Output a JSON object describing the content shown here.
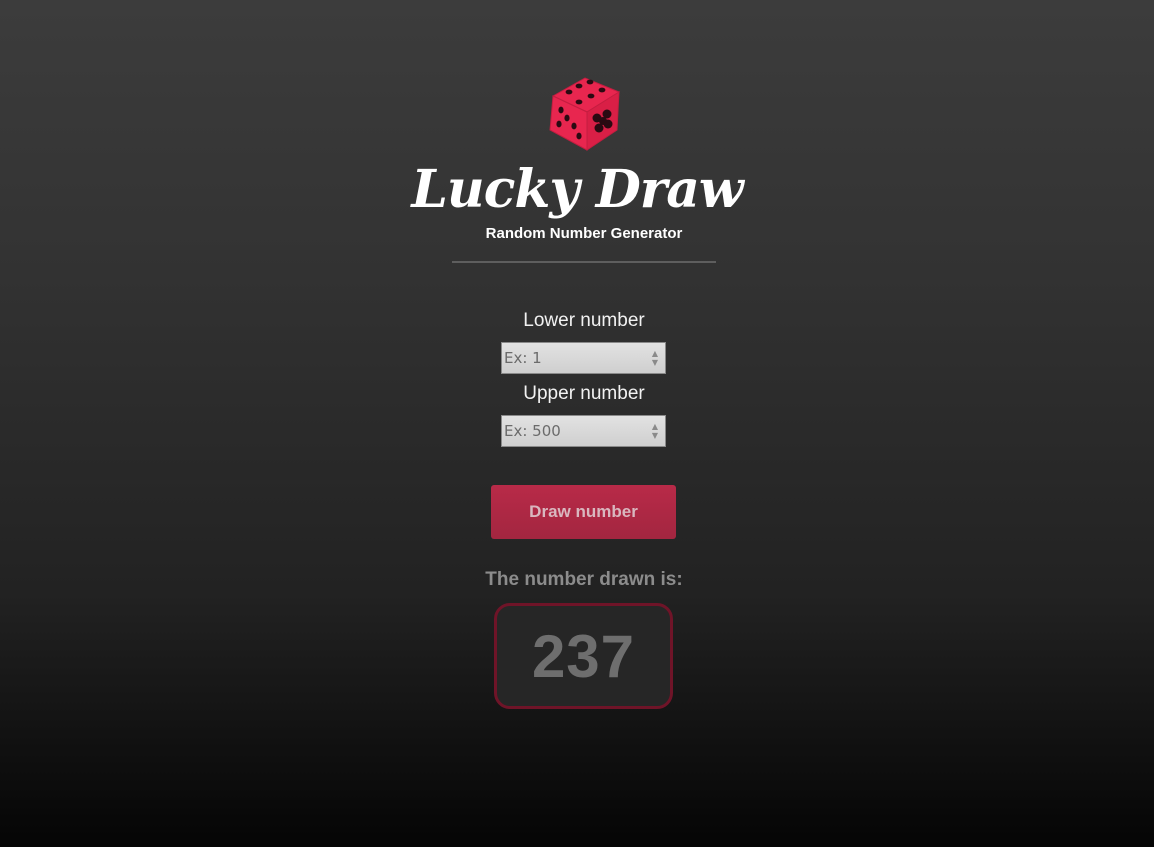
{
  "header": {
    "logo_icon": "dice-icon",
    "title": "Lucky Draw",
    "subtitle": "Random Number Generator"
  },
  "form": {
    "lower": {
      "label": "Lower number",
      "placeholder": "Ex: 1"
    },
    "upper": {
      "label": "Upper number",
      "placeholder": "Ex: 500"
    },
    "draw_button": "Draw number"
  },
  "result": {
    "label": "The number drawn is:",
    "value": "237"
  },
  "colors": {
    "accent": "#e8264f",
    "button": "#b82a48",
    "result_border": "#6f1428"
  }
}
